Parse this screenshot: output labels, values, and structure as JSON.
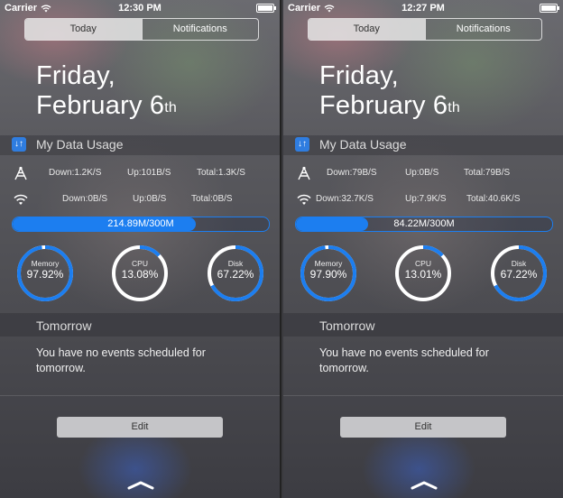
{
  "screens": [
    {
      "status": {
        "carrier": "Carrier",
        "time": "12:30 PM"
      },
      "tabs": {
        "today": "Today",
        "notifications": "Notifications"
      },
      "date": {
        "line1": "Friday,",
        "line2": "February 6",
        "suffix": "th"
      },
      "widget": {
        "icon_text": "↓↑",
        "title": "My Data Usage",
        "cellular": {
          "down": "Down:1.2K/S",
          "up": "Up:101B/S",
          "total": "Total:1.3K/S"
        },
        "wifi": {
          "down": "Down:0B/S",
          "up": "Up:0B/S",
          "total": "Total:0B/S"
        },
        "usage": {
          "text": "214.89M/300M",
          "fraction": 0.7163
        },
        "gauges": [
          {
            "name": "Memory",
            "value": "97.92%",
            "fraction": 0.9792
          },
          {
            "name": "CPU",
            "value": "13.08%",
            "fraction": 0.1308
          },
          {
            "name": "Disk",
            "value": "67.22%",
            "fraction": 0.6722
          }
        ]
      },
      "tomorrow": {
        "title": "Tomorrow",
        "text": "You have no events scheduled for tomorrow."
      },
      "edit_label": "Edit"
    },
    {
      "status": {
        "carrier": "Carrier",
        "time": "12:27 PM"
      },
      "tabs": {
        "today": "Today",
        "notifications": "Notifications"
      },
      "date": {
        "line1": "Friday,",
        "line2": "February 6",
        "suffix": "th"
      },
      "widget": {
        "icon_text": "↓↑",
        "title": "My Data Usage",
        "cellular": {
          "down": "Down:79B/S",
          "up": "Up:0B/S",
          "total": "Total:79B/S"
        },
        "wifi": {
          "down": "Down:32.7K/S",
          "up": "Up:7.9K/S",
          "total": "Total:40.6K/S"
        },
        "usage": {
          "text": "84.22M/300M",
          "fraction": 0.2807
        },
        "gauges": [
          {
            "name": "Memory",
            "value": "97.90%",
            "fraction": 0.979
          },
          {
            "name": "CPU",
            "value": "13.01%",
            "fraction": 0.1301
          },
          {
            "name": "Disk",
            "value": "67.22%",
            "fraction": 0.6722
          }
        ]
      },
      "tomorrow": {
        "title": "Tomorrow",
        "text": "You have no events scheduled for tomorrow."
      },
      "edit_label": "Edit"
    }
  ],
  "colors": {
    "accent": "#1c7ef0",
    "ring_track": "#ffffff"
  }
}
